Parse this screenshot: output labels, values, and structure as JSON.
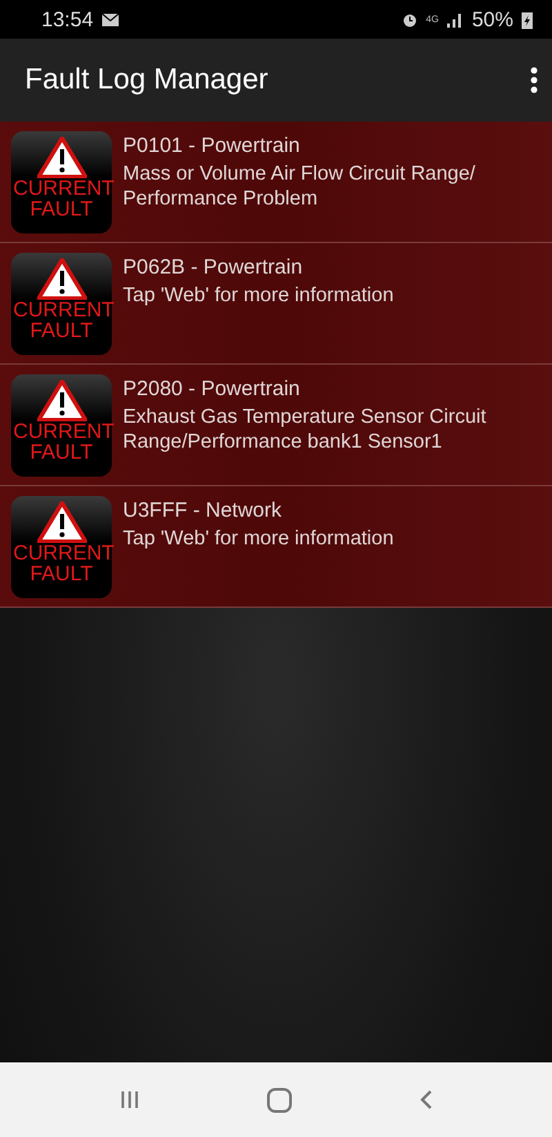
{
  "status_bar": {
    "time": "13:54",
    "network": "4G",
    "battery": "50%"
  },
  "app_bar": {
    "title": "Fault Log Manager"
  },
  "faults": [
    {
      "badge": "CURRENT FAULT",
      "title": "P0101 - Powertrain",
      "description": "Mass or Volume Air Flow Circuit Range/ Performance Problem"
    },
    {
      "badge": "CURRENT FAULT",
      "title": "P062B - Powertrain",
      "description": "Tap 'Web' for more information"
    },
    {
      "badge": "CURRENT FAULT",
      "title": "P2080 - Powertrain",
      "description": "Exhaust Gas Temperature Sensor Circuit Range/Performance bank1 Sensor1"
    },
    {
      "badge": "CURRENT FAULT",
      "title": "U3FFF - Network",
      "description": "Tap 'Web' for more information"
    }
  ]
}
